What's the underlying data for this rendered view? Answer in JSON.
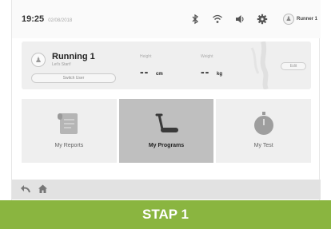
{
  "status_bar": {
    "time": "19:25",
    "date": "02/08/2018",
    "icons": [
      "bluetooth-icon",
      "wifi-icon",
      "volume-icon",
      "settings-icon"
    ],
    "user_name": "Runner 1"
  },
  "profile": {
    "name": "Running 1",
    "subtitle": "Let's Start!",
    "switch_label": "Switch User",
    "height_label": "Height",
    "height_value": "--",
    "height_unit": "cm",
    "weight_label": "Weight",
    "weight_value": "--",
    "weight_unit": "kg",
    "edit_label": "Edit"
  },
  "tiles": [
    {
      "label": "My Reports",
      "icon": "reports-icon",
      "active": false
    },
    {
      "label": "My Programs",
      "icon": "treadmill-icon",
      "active": true
    },
    {
      "label": "My Test",
      "icon": "stopwatch-icon",
      "active": false
    }
  ],
  "nav": {
    "icons": [
      "back-icon",
      "home-icon"
    ]
  },
  "step_banner": {
    "label": "STAP 1"
  },
  "colors": {
    "accent": "#8ab540",
    "active_tile": "#bfbfbf",
    "tile": "#efefef"
  }
}
